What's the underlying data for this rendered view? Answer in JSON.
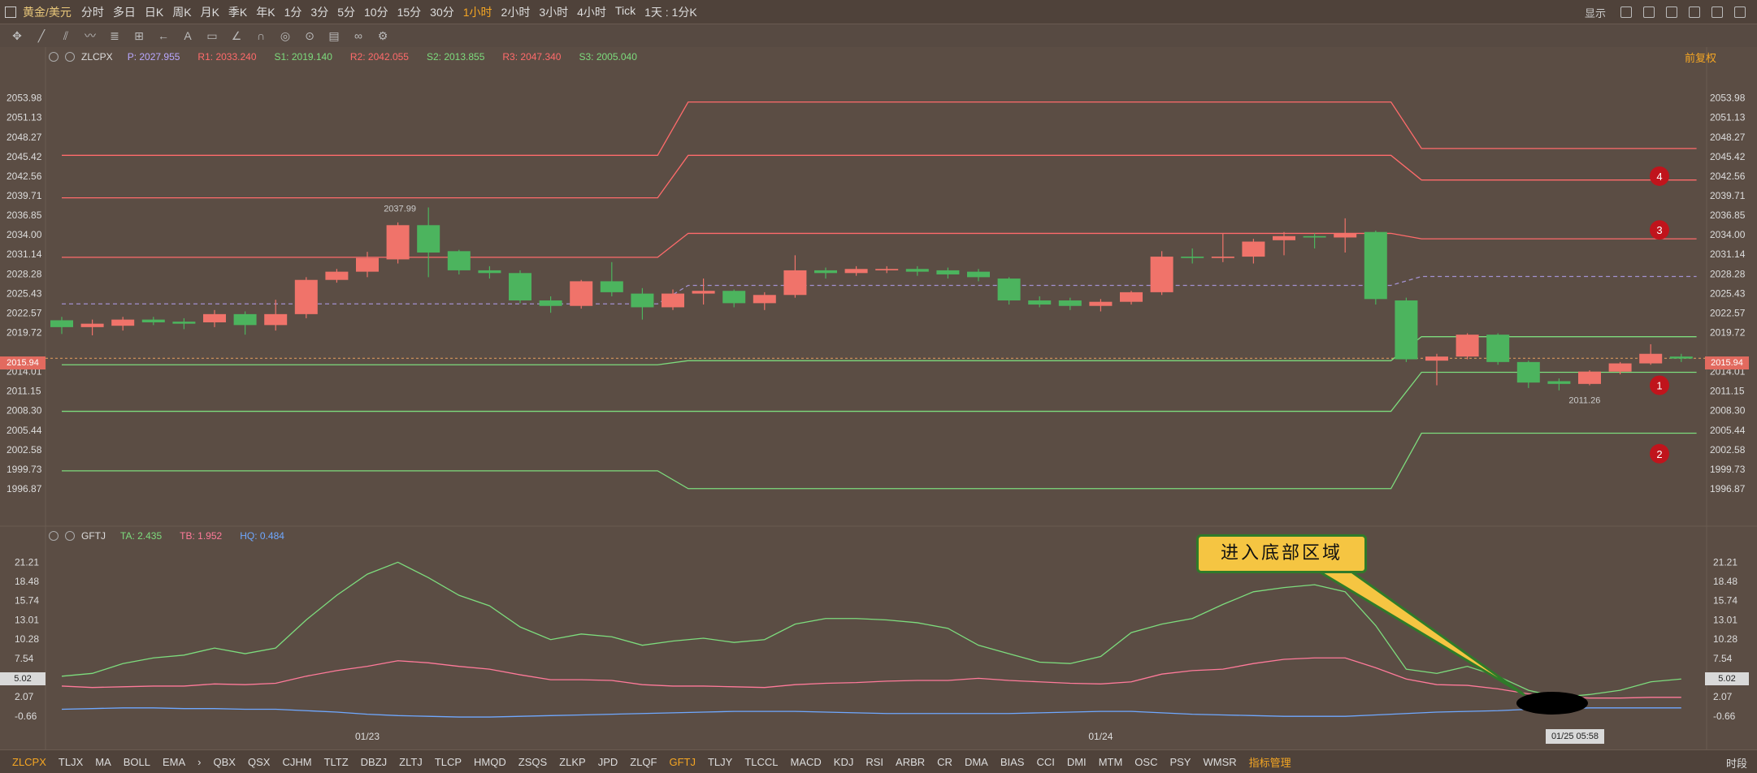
{
  "topbar": {
    "symbol": "黄金/美元",
    "periods": [
      "分时",
      "多日",
      "日K",
      "周K",
      "月K",
      "季K",
      "年K",
      "1分",
      "3分",
      "5分",
      "10分",
      "15分",
      "30分",
      "1小时",
      "2小时",
      "3小时",
      "4小时",
      "Tick",
      "1天 : 1分K"
    ],
    "active_period": "1小时",
    "display_label": "显示"
  },
  "legend_main": {
    "name": "ZLCPX",
    "items": [
      {
        "label": "P:",
        "value": "2027.955",
        "color": "#b9a8ff"
      },
      {
        "label": "R1:",
        "value": "2033.240",
        "color": "#ff6b6b"
      },
      {
        "label": "S1:",
        "value": "2019.140",
        "color": "#7ddc7d"
      },
      {
        "label": "R2:",
        "value": "2042.055",
        "color": "#ff6b6b"
      },
      {
        "label": "S2:",
        "value": "2013.855",
        "color": "#7ddc7d"
      },
      {
        "label": "R3:",
        "value": "2047.340",
        "color": "#ff6b6b"
      },
      {
        "label": "S3:",
        "value": "2005.040",
        "color": "#7ddc7d"
      }
    ],
    "restore_label": "前复权"
  },
  "legend_sub": {
    "name": "GFTJ",
    "items": [
      {
        "label": "TA:",
        "value": "2.435",
        "color": "#7ddc7d"
      },
      {
        "label": "TB:",
        "value": "1.952",
        "color": "#ff7a9a"
      },
      {
        "label": "HQ:",
        "value": "0.484",
        "color": "#6fa8ff"
      }
    ]
  },
  "annotations": {
    "callout_text": "进入底部区域",
    "high_label": "2037.99",
    "low_label": "2011.26",
    "markers": [
      "4",
      "3",
      "1",
      "2"
    ]
  },
  "cursor": {
    "price": "2015.94",
    "time": "01/25 05:58",
    "sub_value": "5.02"
  },
  "bottombar": {
    "tabs": [
      "ZLCPX",
      "TLJX",
      "MA",
      "BOLL",
      "EMA",
      "›",
      "QBX",
      "QSX",
      "CJHM",
      "TLTZ",
      "DBZJ",
      "ZLTJ",
      "TLCP",
      "HMQD",
      "ZSQS",
      "ZLKP",
      "JPD",
      "ZLQF",
      "GFTJ",
      "TLJY",
      "TLCCL",
      "MACD",
      "KDJ",
      "RSI",
      "ARBR",
      "CR",
      "DMA",
      "BIAS",
      "CCI",
      "DMI",
      "MTM",
      "OSC",
      "PSY",
      "WMSR",
      "指标管理"
    ],
    "active_tabs": [
      "ZLCPX",
      "GFTJ"
    ],
    "manage_label": "指标管理",
    "time_label": "时段"
  },
  "chart_data": [
    {
      "type": "candlestick",
      "title": "ZLCPX",
      "x_labels": [
        "01/23",
        "01/24"
      ],
      "y_ticks": [
        2053.98,
        2051.13,
        2048.27,
        2045.42,
        2042.56,
        2039.71,
        2036.85,
        2034.0,
        2031.14,
        2028.28,
        2025.43,
        2022.57,
        2019.72,
        2014.01,
        2011.15,
        2008.3,
        2005.44,
        2002.58,
        1999.73,
        1996.87
      ],
      "ylim": [
        1994.5,
        2056.2
      ],
      "candles": [
        {
          "o": 2021.5,
          "c": 2020.5,
          "h": 2022.0,
          "l": 2019.5
        },
        {
          "o": 2020.5,
          "c": 2021.0,
          "h": 2021.6,
          "l": 2019.3
        },
        {
          "o": 2020.7,
          "c": 2021.6,
          "h": 2022.0,
          "l": 2020.0
        },
        {
          "o": 2021.6,
          "c": 2021.2,
          "h": 2022.0,
          "l": 2020.8
        },
        {
          "o": 2021.3,
          "c": 2021.0,
          "h": 2021.8,
          "l": 2020.2
        },
        {
          "o": 2021.2,
          "c": 2022.4,
          "h": 2023.0,
          "l": 2020.5
        },
        {
          "o": 2022.4,
          "c": 2020.8,
          "h": 2022.8,
          "l": 2019.4
        },
        {
          "o": 2020.8,
          "c": 2022.4,
          "h": 2024.5,
          "l": 2020.0
        },
        {
          "o": 2022.4,
          "c": 2027.4,
          "h": 2027.8,
          "l": 2021.8
        },
        {
          "o": 2027.4,
          "c": 2028.6,
          "h": 2029.0,
          "l": 2027.0
        },
        {
          "o": 2028.6,
          "c": 2030.6,
          "h": 2031.5,
          "l": 2027.8
        },
        {
          "o": 2030.4,
          "c": 2035.4,
          "h": 2035.8,
          "l": 2029.8
        },
        {
          "o": 2035.4,
          "c": 2031.4,
          "h": 2037.99,
          "l": 2027.8
        },
        {
          "o": 2031.6,
          "c": 2028.8,
          "h": 2031.8,
          "l": 2028.2
        },
        {
          "o": 2028.8,
          "c": 2028.4,
          "h": 2029.4,
          "l": 2027.6
        },
        {
          "o": 2028.4,
          "c": 2024.4,
          "h": 2028.8,
          "l": 2024.0
        },
        {
          "o": 2024.4,
          "c": 2023.6,
          "h": 2025.0,
          "l": 2022.6
        },
        {
          "o": 2023.6,
          "c": 2027.2,
          "h": 2027.4,
          "l": 2023.2
        },
        {
          "o": 2027.2,
          "c": 2025.6,
          "h": 2030.0,
          "l": 2025.0
        },
        {
          "o": 2025.4,
          "c": 2023.4,
          "h": 2026.2,
          "l": 2021.6
        },
        {
          "o": 2023.4,
          "c": 2025.4,
          "h": 2026.0,
          "l": 2023.0
        },
        {
          "o": 2025.4,
          "c": 2025.8,
          "h": 2027.6,
          "l": 2023.8
        },
        {
          "o": 2025.8,
          "c": 2024.0,
          "h": 2026.0,
          "l": 2023.4
        },
        {
          "o": 2024.0,
          "c": 2025.2,
          "h": 2025.6,
          "l": 2023.0
        },
        {
          "o": 2025.2,
          "c": 2028.8,
          "h": 2031.0,
          "l": 2024.8
        },
        {
          "o": 2028.8,
          "c": 2028.4,
          "h": 2029.2,
          "l": 2027.6
        },
        {
          "o": 2028.4,
          "c": 2029.0,
          "h": 2029.4,
          "l": 2028.0
        },
        {
          "o": 2028.8,
          "c": 2029.0,
          "h": 2029.4,
          "l": 2028.4
        },
        {
          "o": 2029.0,
          "c": 2028.6,
          "h": 2029.4,
          "l": 2028.0
        },
        {
          "o": 2028.8,
          "c": 2028.2,
          "h": 2029.2,
          "l": 2027.6
        },
        {
          "o": 2028.6,
          "c": 2027.8,
          "h": 2029.0,
          "l": 2027.2
        },
        {
          "o": 2027.6,
          "c": 2024.4,
          "h": 2027.8,
          "l": 2023.8
        },
        {
          "o": 2024.4,
          "c": 2023.8,
          "h": 2025.0,
          "l": 2023.4
        },
        {
          "o": 2024.4,
          "c": 2023.6,
          "h": 2024.8,
          "l": 2023.0
        },
        {
          "o": 2023.6,
          "c": 2024.2,
          "h": 2024.6,
          "l": 2022.8
        },
        {
          "o": 2024.2,
          "c": 2025.6,
          "h": 2025.8,
          "l": 2023.8
        },
        {
          "o": 2025.6,
          "c": 2030.8,
          "h": 2031.6,
          "l": 2025.2
        },
        {
          "o": 2030.8,
          "c": 2030.6,
          "h": 2032.0,
          "l": 2029.8
        },
        {
          "o": 2030.6,
          "c": 2030.8,
          "h": 2034.2,
          "l": 2030.0
        },
        {
          "o": 2030.8,
          "c": 2033.0,
          "h": 2033.4,
          "l": 2029.8
        },
        {
          "o": 2033.2,
          "c": 2033.8,
          "h": 2034.4,
          "l": 2031.0
        },
        {
          "o": 2033.8,
          "c": 2033.6,
          "h": 2034.2,
          "l": 2032.0
        },
        {
          "o": 2033.6,
          "c": 2034.2,
          "h": 2036.4,
          "l": 2031.4
        },
        {
          "o": 2034.4,
          "c": 2024.6,
          "h": 2034.6,
          "l": 2023.8
        },
        {
          "o": 2024.4,
          "c": 2015.8,
          "h": 2024.8,
          "l": 2015.4
        },
        {
          "o": 2015.6,
          "c": 2016.2,
          "h": 2016.6,
          "l": 2012.0
        },
        {
          "o": 2016.2,
          "c": 2019.4,
          "h": 2019.6,
          "l": 2015.8
        },
        {
          "o": 2019.4,
          "c": 2015.4,
          "h": 2019.6,
          "l": 2015.0
        },
        {
          "o": 2015.4,
          "c": 2012.4,
          "h": 2015.6,
          "l": 2011.6
        },
        {
          "o": 2012.6,
          "c": 2012.2,
          "h": 2013.0,
          "l": 2011.26
        },
        {
          "o": 2012.2,
          "c": 2014.0,
          "h": 2014.2,
          "l": 2012.0
        },
        {
          "o": 2014.0,
          "c": 2015.2,
          "h": 2015.4,
          "l": 2013.6
        },
        {
          "o": 2015.2,
          "c": 2016.6,
          "h": 2018.0,
          "l": 2015.0
        },
        {
          "o": 2016.2,
          "c": 2015.9,
          "h": 2016.6,
          "l": 2015.4
        }
      ],
      "pivot_lines": [
        {
          "name": "R3",
          "color": "#ff6b6b",
          "values": [
            {
              "from": 0,
              "to": 19.5,
              "v": 2045.6
            },
            {
              "from": 20.5,
              "to": 43.5,
              "v": 2053.4
            },
            {
              "from": 44.5,
              "to": 53.5,
              "v": 2046.6
            }
          ]
        },
        {
          "name": "R2",
          "color": "#ff6b6b",
          "values": [
            {
              "from": 0,
              "to": 19.5,
              "v": 2039.4
            },
            {
              "from": 20.5,
              "to": 43.5,
              "v": 2045.6
            },
            {
              "from": 44.5,
              "to": 53.5,
              "v": 2042.0
            }
          ]
        },
        {
          "name": "R1",
          "color": "#ff6b6b",
          "values": [
            {
              "from": 0,
              "to": 19.5,
              "v": 2030.7
            },
            {
              "from": 20.5,
              "to": 43.5,
              "v": 2034.2
            },
            {
              "from": 44.5,
              "to": 53.5,
              "v": 2033.4
            }
          ]
        },
        {
          "name": "P",
          "color": "#b9a8ff",
          "dashed": true,
          "values": [
            {
              "from": 0,
              "to": 19.5,
              "v": 2023.9
            },
            {
              "from": 20.5,
              "to": 43.5,
              "v": 2026.6
            },
            {
              "from": 44.5,
              "to": 53.5,
              "v": 2027.9
            }
          ]
        },
        {
          "name": "S1",
          "color": "#7ddc7d",
          "values": [
            {
              "from": 0,
              "to": 19.5,
              "v": 2015.0
            },
            {
              "from": 20.5,
              "to": 43.5,
              "v": 2015.6
            },
            {
              "from": 44.5,
              "to": 53.5,
              "v": 2019.1
            }
          ]
        },
        {
          "name": "S2",
          "color": "#7ddc7d",
          "values": [
            {
              "from": 0,
              "to": 19.5,
              "v": 2008.2
            },
            {
              "from": 20.5,
              "to": 43.5,
              "v": 2008.2
            },
            {
              "from": 44.5,
              "to": 53.5,
              "v": 2013.9
            }
          ]
        },
        {
          "name": "S3",
          "color": "#7ddc7d",
          "values": [
            {
              "from": 0,
              "to": 19.5,
              "v": 1999.5
            },
            {
              "from": 20.5,
              "to": 43.5,
              "v": 1996.9
            },
            {
              "from": 44.5,
              "to": 53.5,
              "v": 2005.0
            }
          ]
        }
      ]
    },
    {
      "type": "line",
      "title": "GFTJ",
      "y_ticks": [
        21.21,
        18.48,
        15.74,
        13.01,
        10.28,
        7.54,
        5.02,
        2.07,
        -0.66
      ],
      "ylim": [
        -1.6,
        22.4
      ],
      "series": [
        {
          "name": "TA",
          "color": "#7ddc7d",
          "values": [
            5.0,
            5.4,
            6.8,
            7.6,
            8.0,
            9.0,
            8.2,
            9.0,
            13.0,
            16.5,
            19.5,
            21.2,
            19.0,
            16.5,
            15.0,
            12.0,
            10.2,
            11.0,
            10.6,
            9.4,
            10.0,
            10.4,
            9.8,
            10.2,
            12.4,
            13.2,
            13.2,
            13.0,
            12.6,
            11.8,
            9.4,
            8.2,
            7.0,
            6.8,
            7.8,
            11.2,
            12.4,
            13.2,
            15.2,
            17.0,
            17.6,
            18.0,
            17.0,
            12.2,
            6.0,
            5.4,
            6.4,
            5.0,
            3.0,
            2.0,
            2.4,
            3.0,
            4.2,
            4.6
          ]
        },
        {
          "name": "TB",
          "color": "#ff7a9a",
          "values": [
            3.6,
            3.4,
            3.5,
            3.6,
            3.6,
            3.9,
            3.8,
            4.0,
            5.0,
            5.8,
            6.4,
            7.2,
            6.9,
            6.4,
            6.0,
            5.2,
            4.5,
            4.5,
            4.4,
            3.8,
            3.6,
            3.6,
            3.5,
            3.4,
            3.8,
            4.0,
            4.1,
            4.3,
            4.4,
            4.4,
            4.7,
            4.4,
            4.2,
            4.0,
            3.9,
            4.2,
            5.3,
            5.8,
            6.0,
            6.8,
            7.4,
            7.6,
            7.6,
            6.2,
            4.6,
            3.8,
            3.7,
            3.2,
            2.5,
            2.1,
            1.9,
            1.9,
            2.0,
            2.0
          ]
        },
        {
          "name": "HQ",
          "color": "#6fa8ff",
          "values": [
            0.3,
            0.4,
            0.5,
            0.5,
            0.4,
            0.4,
            0.3,
            0.3,
            0.1,
            -0.1,
            -0.4,
            -0.6,
            -0.7,
            -0.8,
            -0.8,
            -0.7,
            -0.6,
            -0.5,
            -0.4,
            -0.3,
            -0.2,
            -0.1,
            0.0,
            0.0,
            0.0,
            -0.1,
            -0.2,
            -0.3,
            -0.3,
            -0.3,
            -0.3,
            -0.3,
            -0.2,
            -0.1,
            0.0,
            0.0,
            -0.2,
            -0.4,
            -0.5,
            -0.6,
            -0.7,
            -0.7,
            -0.7,
            -0.5,
            -0.3,
            -0.1,
            0.0,
            0.1,
            0.3,
            0.4,
            0.5,
            0.5,
            0.5,
            0.5
          ]
        }
      ]
    }
  ]
}
